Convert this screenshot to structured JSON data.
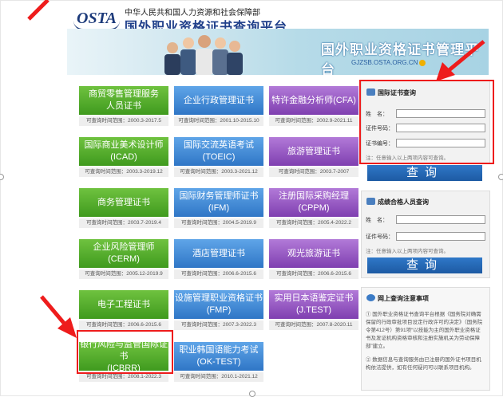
{
  "header": {
    "logo_text": "OSTA",
    "ministry": "中华人民共和国人力资源和社会保障部",
    "platform": "国外职业资格证书查询平台"
  },
  "banner": {
    "title": "国外职业资格证书管理平台",
    "url": "GJZSB.OSTA.ORG.CN"
  },
  "certificates": [
    {
      "name1": "商贸零售管理服务",
      "name2": "人员证书",
      "period": "可查询时间范围：2000.3-2017.5",
      "color": "green"
    },
    {
      "name1": "企业行政管理证书",
      "name2": "",
      "period": "可查询时间范围：2001.10-2015.10",
      "color": "blue"
    },
    {
      "name1": "特许金融分析师(CFA)",
      "name2": "",
      "period": "可查询时间范围：2002.9-2021.11",
      "color": "purple"
    },
    {
      "name1": "国际商业美术设计师",
      "name2": "(ICAD)",
      "period": "可查询时间范围：2003.3-2019.12",
      "color": "green"
    },
    {
      "name1": "国际交流英语考试",
      "name2": "(TOEIC)",
      "period": "可查询时间范围：2003.3-2021.12",
      "color": "blue"
    },
    {
      "name1": "旅游管理证书",
      "name2": "",
      "period": "可查询时间范围：2003.7-2007",
      "color": "purple"
    },
    {
      "name1": "商务管理证书",
      "name2": "",
      "period": "可查询时间范围：2003.7-2019.4",
      "color": "green"
    },
    {
      "name1": "国际财务管理师证书",
      "name2": "(IFM)",
      "period": "可查询时间范围：2004.5-2019.9",
      "color": "blue"
    },
    {
      "name1": "注册国际采购经理",
      "name2": "(CPPM)",
      "period": "可查询时间范围：2005.4-2022.2",
      "color": "purple"
    },
    {
      "name1": "企业风险管理师",
      "name2": "(CERM)",
      "period": "可查询时间范围：2005.12-2019.9",
      "color": "green"
    },
    {
      "name1": "酒店管理证书",
      "name2": "",
      "period": "可查询时间范围：2006.6-2015.6",
      "color": "blue"
    },
    {
      "name1": "观光旅游证书",
      "name2": "",
      "period": "可查询时间范围：2006.6-2015.6",
      "color": "purple"
    },
    {
      "name1": "电子工程证书",
      "name2": "",
      "period": "可查询时间范围：2006.6-2015.6",
      "color": "green"
    },
    {
      "name1": "设施管理职业资格证书",
      "name2": "(FMP)",
      "period": "可查询时间范围：2007.3-2022.3",
      "color": "blue"
    },
    {
      "name1": "实用日本语鉴定证书",
      "name2": "(J.TEST)",
      "period": "可查询时间范围：2007.8-2020.11",
      "color": "purple"
    },
    {
      "name1": "银行风险与监管国际证书",
      "name2": "(ICBRR)",
      "period": "可查询时间范围：2008.1-2022.3",
      "color": "green"
    },
    {
      "name1": "职业韩国语能力考试",
      "name2": "(OK-TEST)",
      "period": "可查询时间范围：2010.1-2021.12",
      "color": "blue"
    }
  ],
  "cert_query": {
    "title": "国际证书查询",
    "name_label": "姓　名：",
    "id_label": "证件号码：",
    "cert_no_label": "证书编号：",
    "note": "注：任意输入以上两项内容可查询。",
    "button": "查询"
  },
  "qualified_query": {
    "title": "成绩合格人员查询",
    "name_label": "姓　名：",
    "id_label": "证件号码：",
    "note": "注：任意输入以上两项内容可查询。",
    "button": "查询"
  },
  "notice": {
    "title": "网上查询注意事项",
    "p1": "① 国外职业资格证书查询平台根据《国务院对确需保留的行政审批项目设定行政许可的决定》（国务院令第412号）第91项“以技能为主的国外职业资格证书及发证机构资格审核和注册实施机关为劳动保障部”建立。",
    "p2": "② 数据信息与查询服务由已注册的国外证书项目机构依法提供，如有任何疑问可以联系项目机构。"
  },
  "colors": {
    "green": "#4fa82a",
    "blue": "#3a86d6",
    "purple": "#9350c4",
    "highlight": "#ee1c1c",
    "button": "#2569b8"
  }
}
